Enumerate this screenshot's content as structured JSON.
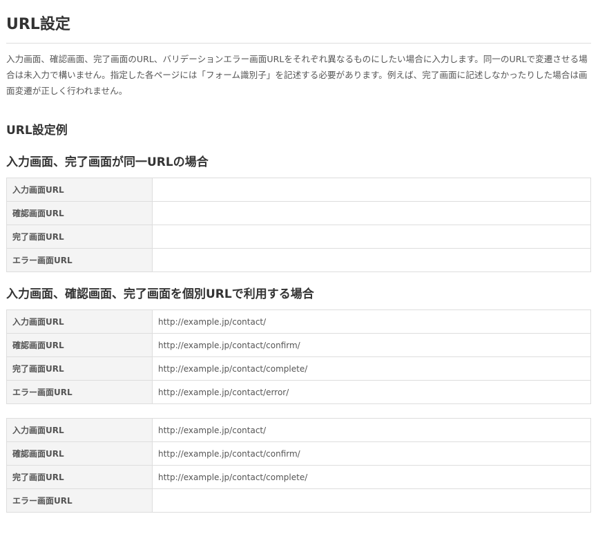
{
  "page": {
    "title": "URL設定",
    "description": "入力画面、確認画面、完了画面のURL、バリデーションエラー画面URLをそれぞれ異なるものにしたい場合に入力します。同一のURLで変遷させる場合は未入力で構いません。指定した各ページには「フォーム識別子」を記述する必要があります。例えば、完了画面に記述しなかったりした場合は画面変遷が正しく行われません。"
  },
  "example": {
    "heading": "URL設定例",
    "case_same": {
      "heading": "入力画面、完了画面が同一URLの場合",
      "rows": [
        {
          "label": "入力画面URL",
          "value": ""
        },
        {
          "label": "確認画面URL",
          "value": ""
        },
        {
          "label": "完了画面URL",
          "value": ""
        },
        {
          "label": "エラー画面URL",
          "value": ""
        }
      ]
    },
    "case_individual": {
      "heading": "入力画面、確認画面、完了画面を個別URLで利用する場合",
      "table_a": {
        "rows": [
          {
            "label": "入力画面URL",
            "value": "http://example.jp/contact/"
          },
          {
            "label": "確認画面URL",
            "value": "http://example.jp/contact/confirm/"
          },
          {
            "label": "完了画面URL",
            "value": "http://example.jp/contact/complete/"
          },
          {
            "label": "エラー画面URL",
            "value": "http://example.jp/contact/error/"
          }
        ]
      },
      "table_b": {
        "rows": [
          {
            "label": "入力画面URL",
            "value": "http://example.jp/contact/"
          },
          {
            "label": "確認画面URL",
            "value": "http://example.jp/contact/confirm/"
          },
          {
            "label": "完了画面URL",
            "value": "http://example.jp/contact/complete/"
          },
          {
            "label": "エラー画面URL",
            "value": ""
          }
        ]
      }
    }
  }
}
